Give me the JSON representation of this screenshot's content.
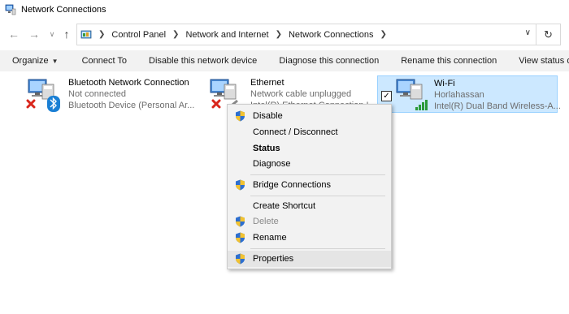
{
  "window": {
    "title": "Network Connections"
  },
  "address": {
    "crumbs": [
      "Control Panel",
      "Network and Internet",
      "Network Connections"
    ]
  },
  "toolbar": {
    "organize": "Organize",
    "connect_to": "Connect To",
    "disable": "Disable this network device",
    "diagnose": "Diagnose this connection",
    "rename": "Rename this connection",
    "view_status": "View status of this"
  },
  "connections": [
    {
      "name": "Bluetooth Network Connection",
      "status": "Not connected",
      "device": "Bluetooth Device (Personal Ar..."
    },
    {
      "name": "Ethernet",
      "status": "Network cable unplugged",
      "device": "Intel(R) Ethernet Connection I..."
    },
    {
      "name": "Wi-Fi",
      "status": "Horlahassan",
      "device": "Intel(R) Dual Band Wireless-A..."
    }
  ],
  "context_menu": {
    "disable": "Disable",
    "connect_disconnect": "Connect / Disconnect",
    "status": "Status",
    "diagnose": "Diagnose",
    "bridge": "Bridge Connections",
    "shortcut": "Create Shortcut",
    "delete": "Delete",
    "rename": "Rename",
    "properties": "Properties"
  },
  "colors": {
    "selection": "#cce8ff",
    "selection_border": "#99d1ff",
    "error_x": "#d9261c",
    "bluetooth": "#1a7fd4",
    "signal": "#2a9a3a"
  }
}
